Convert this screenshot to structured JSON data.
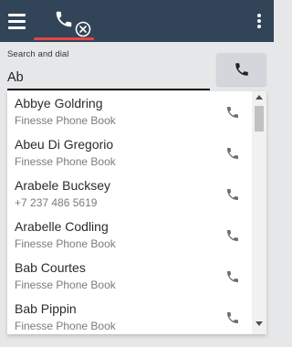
{
  "header": {
    "menu_icon": "hamburger-menu-icon",
    "tab_icon": "phone-icon",
    "tab_badge_icon": "circle-x-icon",
    "more_icon": "vertical-dots-icon",
    "accent_color": "#e2444c",
    "bar_color": "#324457"
  },
  "search": {
    "label": "Search and dial",
    "value": "Ab",
    "dial_icon": "phone-icon"
  },
  "contacts": [
    {
      "name": "Abbye Goldring",
      "detail": "Finesse Phone Book"
    },
    {
      "name": "Abeu Di Gregorio",
      "detail": "Finesse Phone Book"
    },
    {
      "name": "Arabele Bucksey",
      "detail": "+7 237 486 5619"
    },
    {
      "name": "Arabelle Codling",
      "detail": "Finesse Phone Book"
    },
    {
      "name": "Bab Courtes",
      "detail": "Finesse Phone Book"
    },
    {
      "name": "Bab Pippin",
      "detail": "Finesse Phone Book"
    }
  ]
}
